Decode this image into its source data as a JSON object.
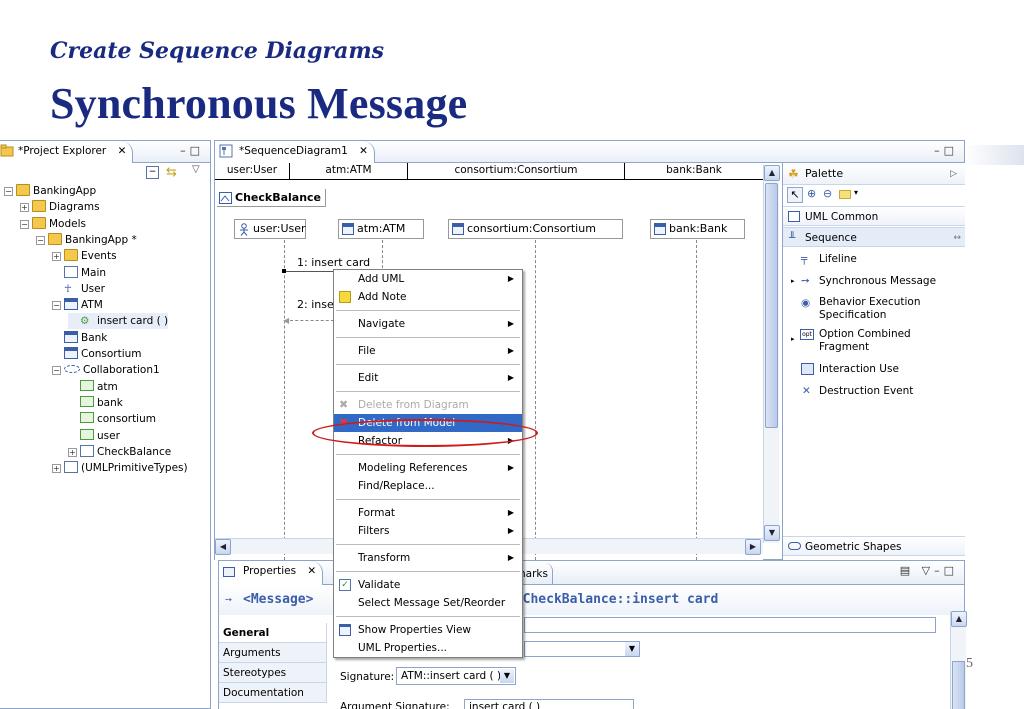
{
  "slide": {
    "subtitle": "Create Sequence Diagrams",
    "title": "Synchronous Message",
    "page_number": "5"
  },
  "explorer": {
    "tab_label": "*Project Explorer",
    "tree": [
      {
        "label": "BankingApp",
        "icon": "project-folder-icon"
      },
      {
        "label": "Diagrams",
        "icon": "diagrams-folder-icon"
      },
      {
        "label": "Models",
        "icon": "models-folder-icon"
      },
      {
        "label": "BankingApp *",
        "icon": "package-icon"
      },
      {
        "label": "Events",
        "icon": "events-folder-icon"
      },
      {
        "label": "Main",
        "icon": "document-icon"
      },
      {
        "label": "User",
        "icon": "actor-icon"
      },
      {
        "label": "ATM",
        "icon": "class-icon"
      },
      {
        "label": "insert card ( )",
        "icon": "operation-icon"
      },
      {
        "label": "Bank",
        "icon": "class-icon"
      },
      {
        "label": "Consortium",
        "icon": "class-icon"
      },
      {
        "label": "Collaboration1",
        "icon": "collaboration-icon"
      },
      {
        "label": "atm",
        "icon": "part-icon"
      },
      {
        "label": "bank",
        "icon": "part-icon"
      },
      {
        "label": "consortium",
        "icon": "part-icon"
      },
      {
        "label": "user",
        "icon": "part-icon"
      },
      {
        "label": "CheckBalance",
        "icon": "interaction-icon"
      },
      {
        "label": "(UMLPrimitiveTypes)",
        "icon": "library-icon"
      }
    ]
  },
  "editor": {
    "tab_label": "*SequenceDiagram1",
    "header_cells": [
      "user:User",
      "atm:ATM",
      "consortium:Consortium",
      "bank:Bank"
    ],
    "frame_label": "CheckBalance",
    "lifelines": [
      "user:User",
      "atm:ATM",
      "consortium:Consortium",
      "bank:Bank"
    ],
    "messages": [
      "1: insert card",
      "2: inse"
    ]
  },
  "context_menu": {
    "items": [
      {
        "label": "Add UML",
        "submenu": true
      },
      {
        "label": "Add Note",
        "icon": "note-icon"
      },
      {
        "label": "Navigate",
        "submenu": true
      },
      {
        "label": "File",
        "submenu": true
      },
      {
        "label": "Edit",
        "submenu": true
      },
      {
        "label": "Delete from Diagram",
        "disabled": true,
        "icon": "delete-gray-icon"
      },
      {
        "label": "Delete from Model",
        "selected": true,
        "icon": "delete-red-icon"
      },
      {
        "label": "Refactor",
        "submenu": true
      },
      {
        "label": "Modeling References",
        "submenu": true
      },
      {
        "label": "Find/Replace..."
      },
      {
        "label": "Format",
        "submenu": true
      },
      {
        "label": "Filters",
        "submenu": true
      },
      {
        "label": "Transform",
        "submenu": true
      },
      {
        "label": "Validate",
        "icon": "validate-icon"
      },
      {
        "label": "Select Message Set/Reorder"
      },
      {
        "label": "Show Properties View",
        "icon": "properties-icon"
      },
      {
        "label": "UML Properties..."
      }
    ]
  },
  "palette": {
    "title": "Palette",
    "drawers": [
      "UML Common",
      "Sequence",
      "Geometric Shapes"
    ],
    "items": [
      "Lifeline",
      "Synchronous Message",
      "Behavior Execution Specification",
      "Option Combined Fragment",
      "Interaction Use",
      "Destruction Event"
    ]
  },
  "properties": {
    "tab_label": "Properties",
    "second_tab_partial": "narks",
    "element_label": "<Message>",
    "path_label": "::CheckBalance::insert card",
    "sections": [
      "General",
      "Arguments",
      "Stereotypes",
      "Documentation"
    ],
    "signature_label": "Signature:",
    "signature_value": "ATM::insert card ( )",
    "arg_signature_label": "Argument Signature:",
    "arg_signature_value": "insert card ( )"
  },
  "colors": {
    "accent": "#1a2a80",
    "highlight": "#d21a1a",
    "selection": "#3169c6",
    "border": "#8ea4c8"
  }
}
